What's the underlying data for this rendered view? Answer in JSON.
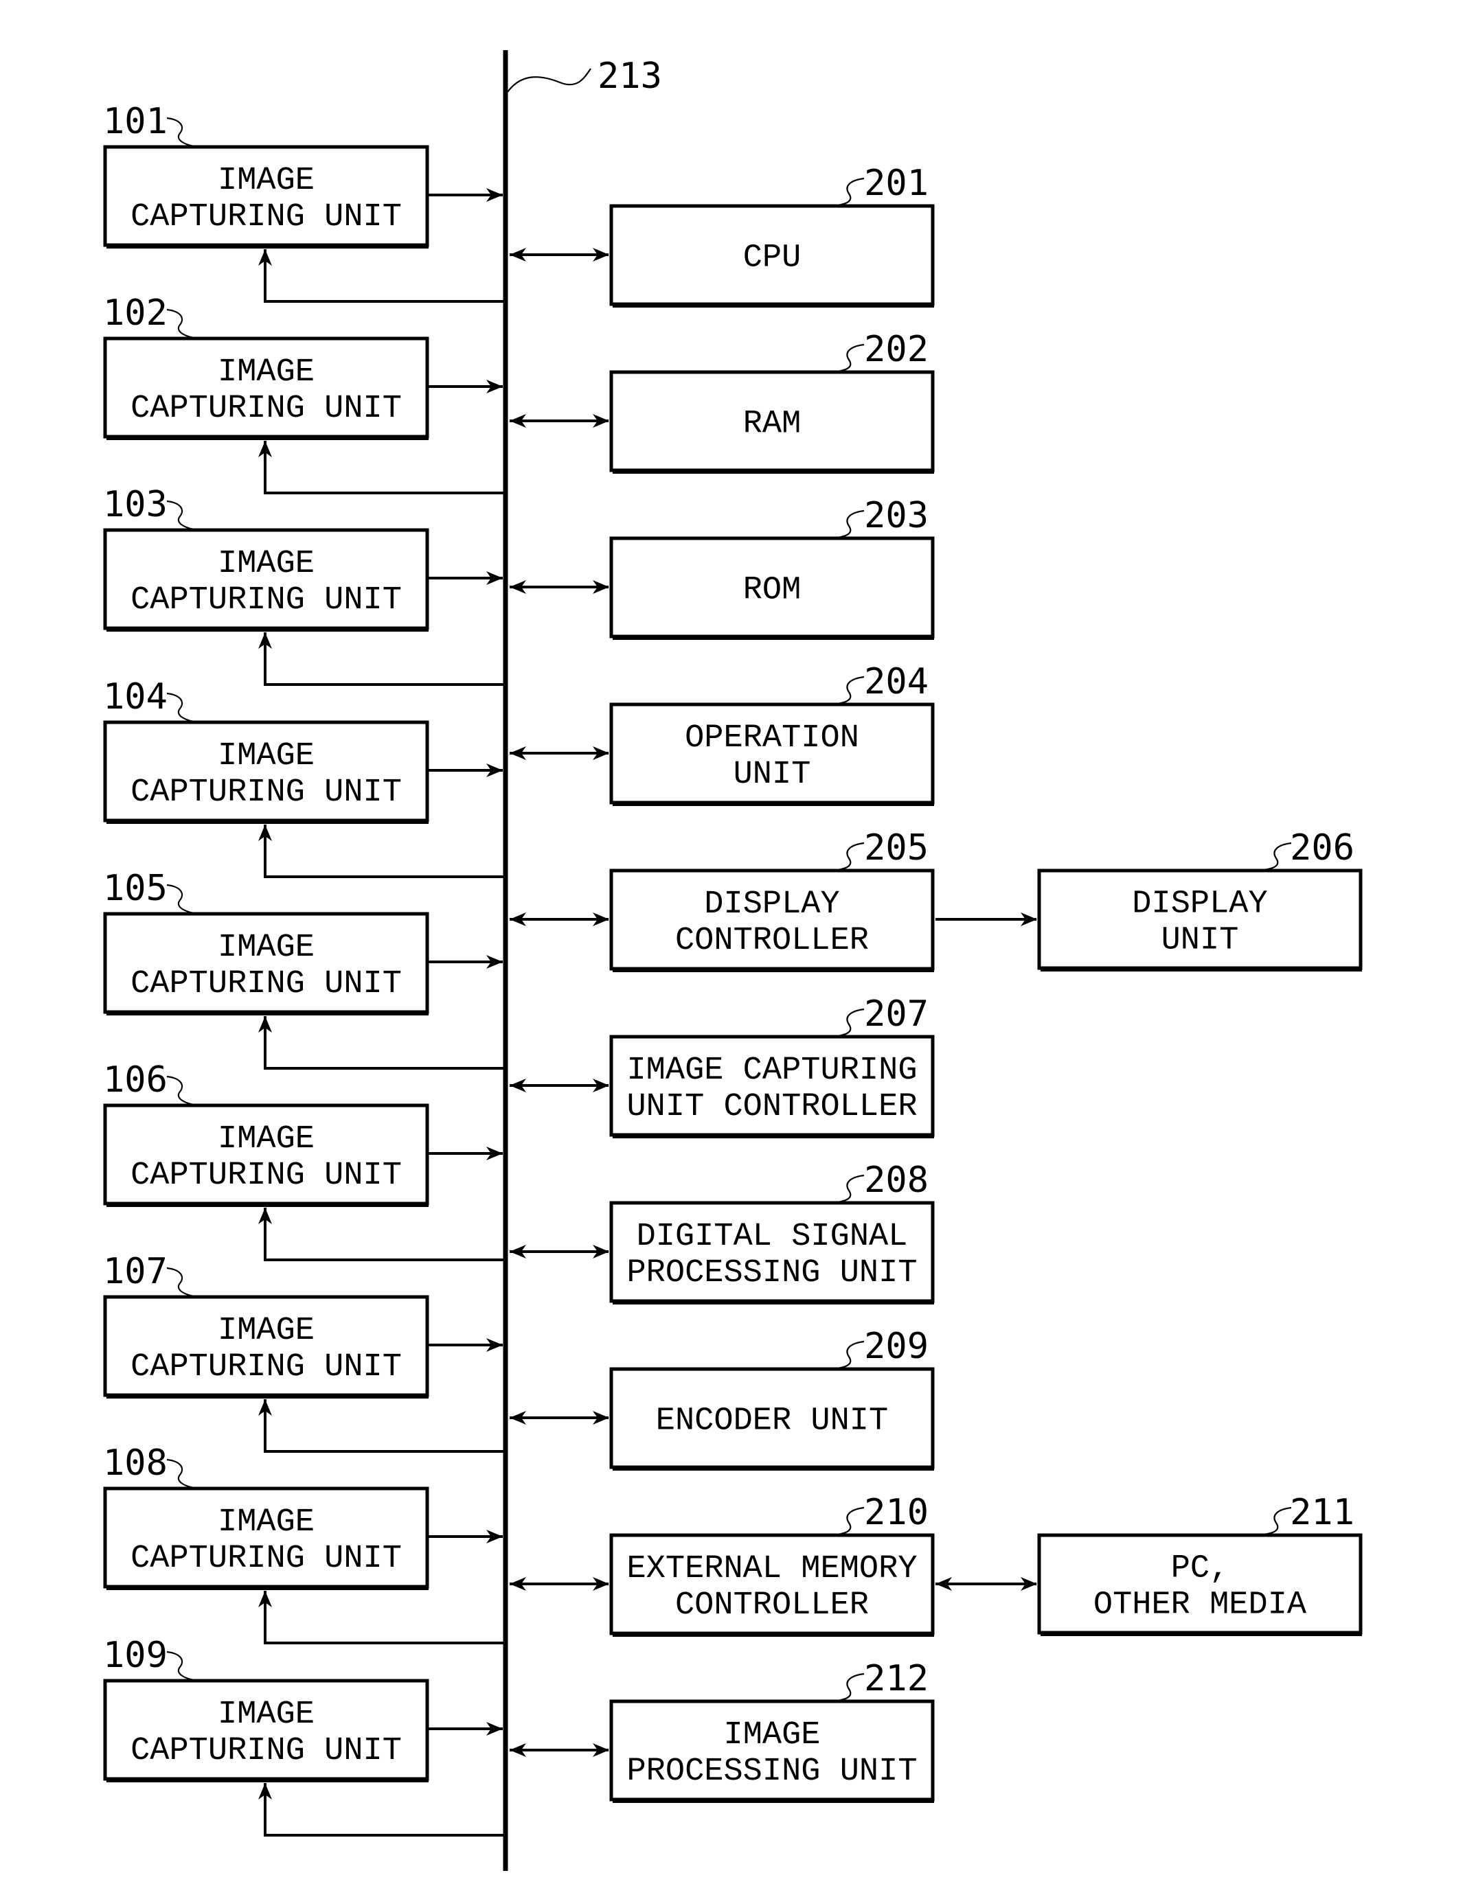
{
  "figure": {
    "bus": {
      "ref": "213"
    },
    "image_capturing_units": [
      {
        "ref": "101",
        "lines": [
          "IMAGE",
          "CAPTURING UNIT"
        ]
      },
      {
        "ref": "102",
        "lines": [
          "IMAGE",
          "CAPTURING UNIT"
        ]
      },
      {
        "ref": "103",
        "lines": [
          "IMAGE",
          "CAPTURING UNIT"
        ]
      },
      {
        "ref": "104",
        "lines": [
          "IMAGE",
          "CAPTURING UNIT"
        ]
      },
      {
        "ref": "105",
        "lines": [
          "IMAGE",
          "CAPTURING UNIT"
        ]
      },
      {
        "ref": "106",
        "lines": [
          "IMAGE",
          "CAPTURING UNIT"
        ]
      },
      {
        "ref": "107",
        "lines": [
          "IMAGE",
          "CAPTURING UNIT"
        ]
      },
      {
        "ref": "108",
        "lines": [
          "IMAGE",
          "CAPTURING UNIT"
        ]
      },
      {
        "ref": "109",
        "lines": [
          "IMAGE",
          "CAPTURING UNIT"
        ]
      }
    ],
    "bus_components": [
      {
        "ref": "201",
        "lines": [
          "CPU"
        ]
      },
      {
        "ref": "202",
        "lines": [
          "RAM"
        ]
      },
      {
        "ref": "203",
        "lines": [
          "ROM"
        ]
      },
      {
        "ref": "204",
        "lines": [
          "OPERATION",
          "UNIT"
        ]
      },
      {
        "ref": "205",
        "lines": [
          "DISPLAY",
          "CONTROLLER"
        ]
      },
      {
        "ref": "207",
        "lines": [
          "IMAGE CAPTURING",
          "UNIT CONTROLLER"
        ]
      },
      {
        "ref": "208",
        "lines": [
          "DIGITAL SIGNAL",
          "PROCESSING UNIT"
        ]
      },
      {
        "ref": "209",
        "lines": [
          "ENCODER UNIT"
        ]
      },
      {
        "ref": "210",
        "lines": [
          "EXTERNAL MEMORY",
          "CONTROLLER"
        ]
      },
      {
        "ref": "212",
        "lines": [
          "IMAGE",
          "PROCESSING UNIT"
        ]
      }
    ],
    "peripherals": [
      {
        "ref": "206",
        "lines": [
          "DISPLAY",
          "UNIT"
        ],
        "attached_to": "205",
        "connection": "one-way"
      },
      {
        "ref": "211",
        "lines": [
          "PC,",
          "OTHER MEDIA"
        ],
        "attached_to": "210",
        "connection": "two-way"
      }
    ]
  }
}
